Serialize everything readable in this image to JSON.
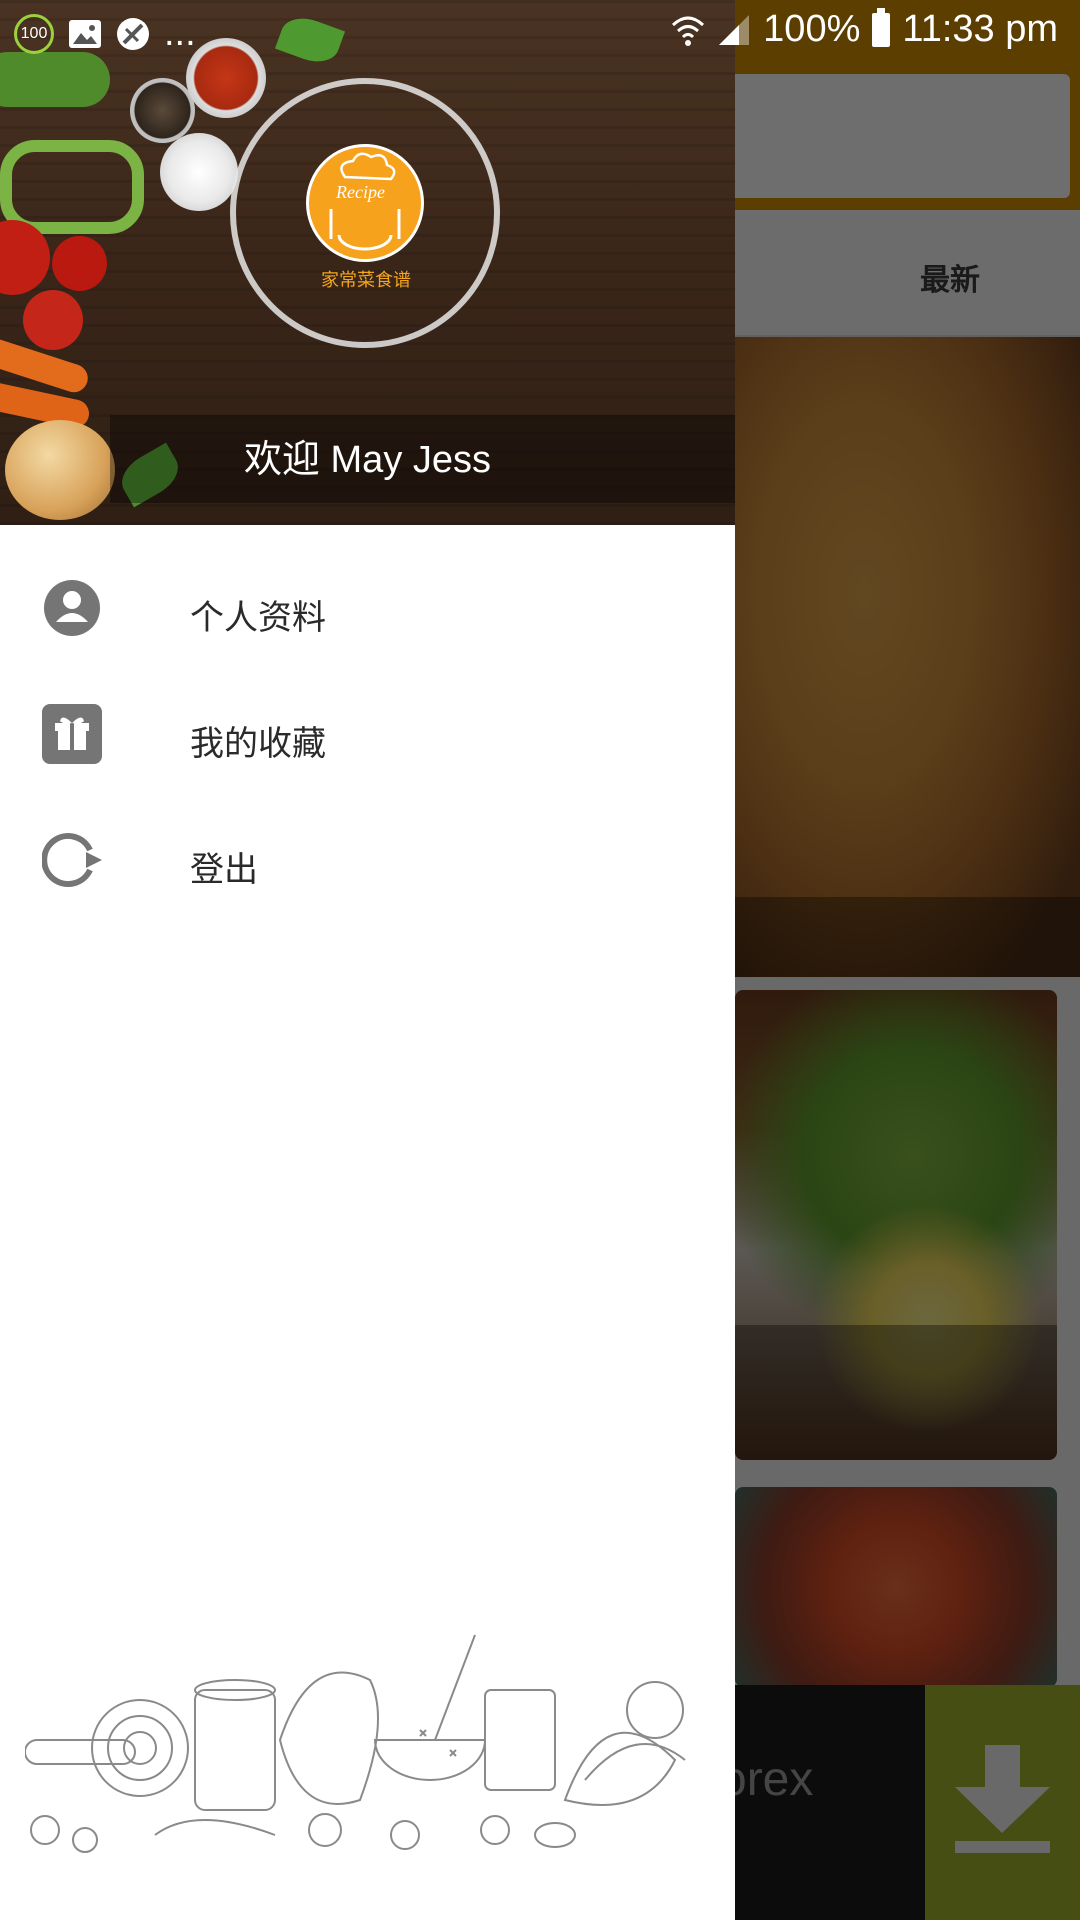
{
  "status_bar": {
    "badge": "100",
    "ellipsis": "...",
    "battery": "100%",
    "time": "11:33 pm"
  },
  "drawer": {
    "logo": {
      "recipe_word": "Recipe",
      "caption": "家常菜食谱"
    },
    "welcome": "欢迎 May Jess",
    "menu": [
      {
        "label": "个人资料",
        "icon": "profile-icon"
      },
      {
        "label": "我的收藏",
        "icon": "gift-icon"
      },
      {
        "label": "登出",
        "icon": "logout-icon"
      }
    ]
  },
  "background_app": {
    "tab_latest": "最新",
    "ad_text": "orex"
  },
  "colors": {
    "accent": "#c98a00",
    "logo_orange": "#f6a21d",
    "download_green": "#9cae2a"
  }
}
